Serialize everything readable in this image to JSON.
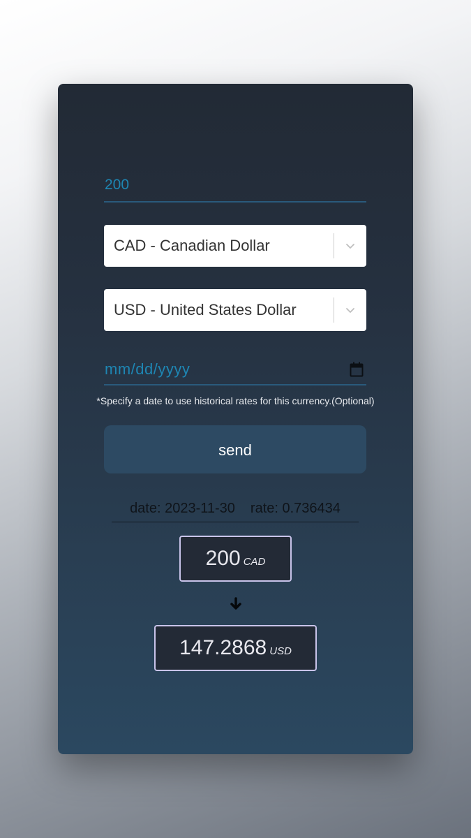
{
  "converter": {
    "amount": "200",
    "from_currency": "CAD - Canadian Dollar",
    "to_currency": "USD - United States Dollar",
    "date_placeholder": "mm/dd/yyyy",
    "hint": "*Specify a date to use historical rates for this currency.(Optional)",
    "send_label": "send"
  },
  "result": {
    "date_text": "date: 2023-11-30",
    "rate_text": "rate: 0.736434",
    "from_amount": "200",
    "from_code": "CAD",
    "to_amount": "147.2868",
    "to_code": "USD"
  },
  "icons": {
    "select_chevron": "chevron-down-icon",
    "date_picker": "calendar-icon",
    "conversion": "arrow-down-icon"
  },
  "colors": {
    "accent": "#1e86b3",
    "button": "#2d4a63",
    "result_border": "#c9c4ea"
  }
}
